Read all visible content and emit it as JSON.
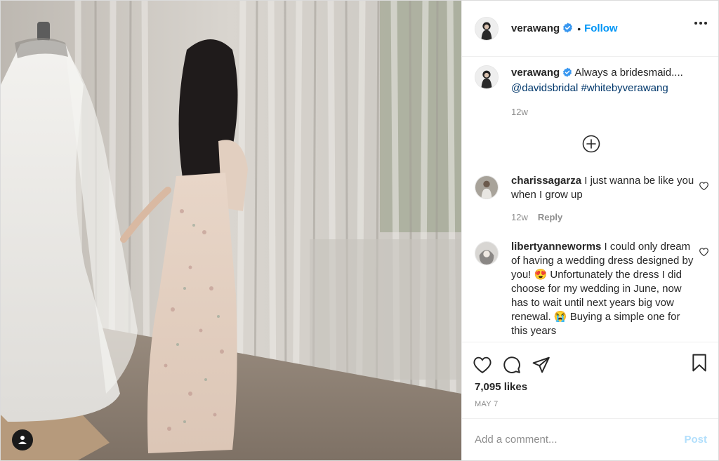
{
  "account": {
    "username": "verawang",
    "follow_label": "Follow",
    "separator": "•"
  },
  "caption": {
    "username": "verawang",
    "text": "Always a bridesmaid....",
    "mention": "@davidsbridal",
    "hashtag": "#whitebyverawang",
    "time": "12w"
  },
  "comments": [
    {
      "username": "charissagarza",
      "text": "I just wanna be like you when I grow up",
      "time": "12w",
      "reply_label": "Reply"
    },
    {
      "username": "libertyanneworms",
      "text": "I could only dream of having a wedding dress designed by you! 😍 Unfortunately the dress I did choose for my wedding in June, now has to wait until next years big vow renewal. 😭 Buying a simple one for this years"
    }
  ],
  "likes": "7,095 likes",
  "date": "MAY 7",
  "add_comment": {
    "placeholder": "Add a comment...",
    "post_label": "Post"
  },
  "colors": {
    "accent": "#0095f6",
    "post_disabled": "#b2dffc",
    "link": "#00376b",
    "muted": "#8e8e8e",
    "text": "#262626"
  },
  "icons": [
    "user-tag-icon",
    "verified-badge-icon",
    "more-options-icon",
    "load-more-comments-icon",
    "heart-icon",
    "comment-icon",
    "share-icon",
    "bookmark-icon"
  ]
}
